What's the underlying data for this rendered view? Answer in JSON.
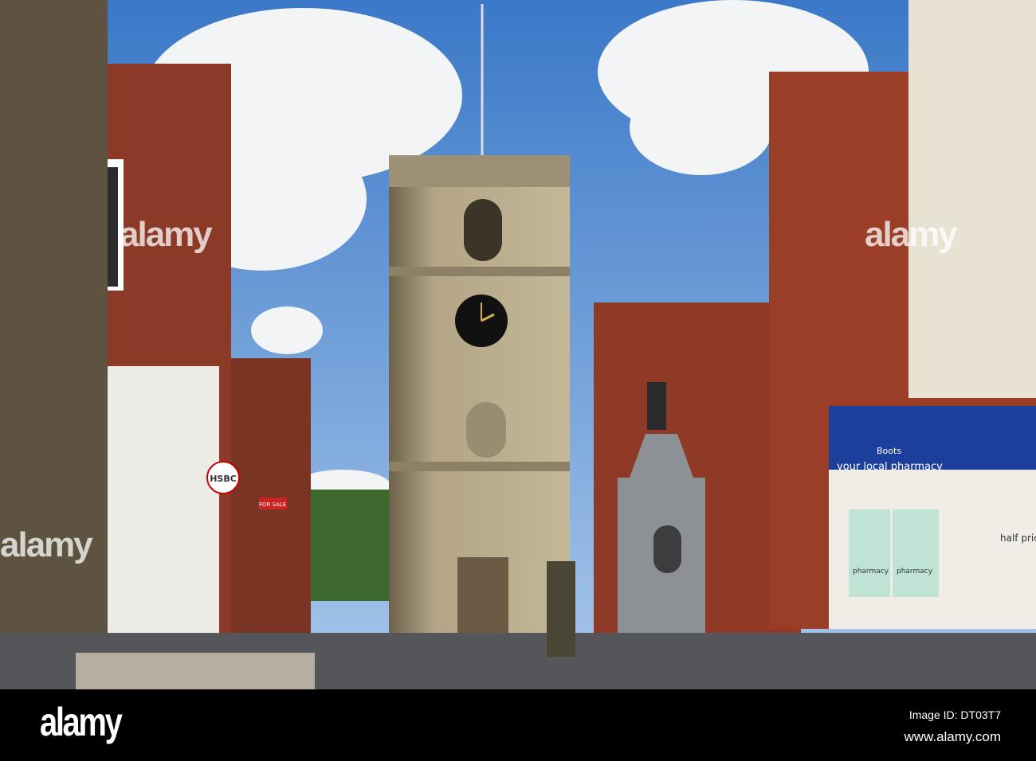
{
  "signs": {
    "bank": "HSBC",
    "for_sale": "FOR SALE",
    "pharmacy_fascia": "your local pharmacy",
    "pharmacy_brand": "Boots",
    "pharmacy_window_1": "pharmacy",
    "pharmacy_window_2": "pharmacy",
    "poster": "half price"
  },
  "watermark": {
    "text": "alamy"
  },
  "footer": {
    "logo": "alamy",
    "image_id": "Image ID: DT03T7",
    "website": "www.alamy.com"
  },
  "colors": {
    "sky": "#4a86d0",
    "brick": "#8a3a28",
    "stone": "#a89878",
    "boots_blue": "#1d3f9c"
  }
}
